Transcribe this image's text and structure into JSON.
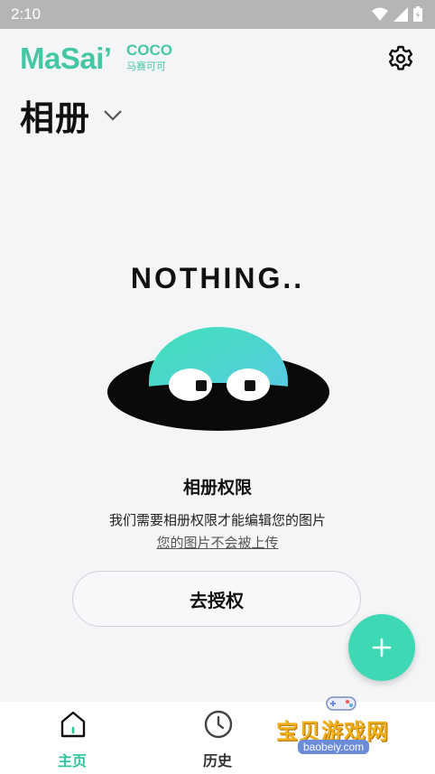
{
  "status_bar": {
    "time": "2:10"
  },
  "header": {
    "logo_main": "MaSai",
    "logo_apostrophe": "’",
    "logo_sub": "COCO",
    "logo_cn": "马赛可可",
    "title": "相册"
  },
  "empty_state": {
    "heading": "NOTHING..",
    "perm_title": "相册权限",
    "perm_desc": "我们需要相册权限才能编辑您的图片",
    "perm_link": "您的图片不会被上传",
    "auth_button": "去授权"
  },
  "tabs": [
    {
      "label": "主页",
      "icon": "home-icon",
      "active": true
    },
    {
      "label": "历史",
      "icon": "clock-icon",
      "active": false
    }
  ],
  "watermark": {
    "text": "宝贝游戏网",
    "url": "baobeiy.com"
  },
  "colors": {
    "accent": "#3fd8b4",
    "brand": "#45c7a5",
    "background": "#f4f5f7"
  }
}
